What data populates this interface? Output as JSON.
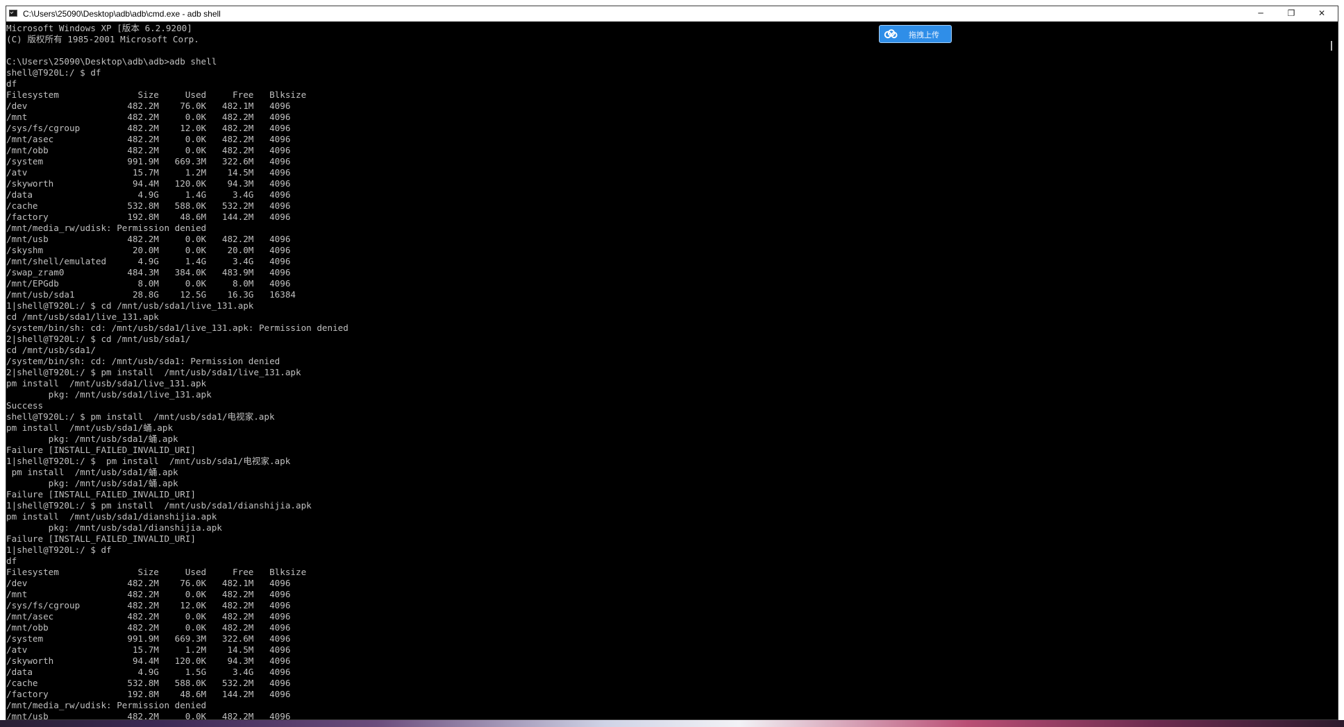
{
  "window": {
    "title": "C:\\Users\\25090\\Desktop\\adb\\adb\\cmd.exe - adb shell",
    "buttons": {
      "minimize": "─",
      "maximize": "❐",
      "close": "✕"
    }
  },
  "upload_widget": {
    "label": "拖拽上传",
    "color": "#2f8ee8",
    "icon": "cloud-icon"
  },
  "console": {
    "text_color": "#c0c0c0",
    "background": "#000000",
    "text": "Microsoft Windows XP [版本 6.2.9200]\n(C) 版权所有 1985-2001 Microsoft Corp.\n\nC:\\Users\\25090\\Desktop\\adb\\adb>adb shell\nshell@T920L:/ $ df\ndf\nFilesystem               Size     Used     Free   Blksize\n/dev                   482.2M    76.0K   482.1M   4096\n/mnt                   482.2M     0.0K   482.2M   4096\n/sys/fs/cgroup         482.2M    12.0K   482.2M   4096\n/mnt/asec              482.2M     0.0K   482.2M   4096\n/mnt/obb               482.2M     0.0K   482.2M   4096\n/system                991.9M   669.3M   322.6M   4096\n/atv                    15.7M     1.2M    14.5M   4096\n/skyworth               94.4M   120.0K    94.3M   4096\n/data                    4.9G     1.4G     3.4G   4096\n/cache                 532.8M   588.0K   532.2M   4096\n/factory               192.8M    48.6M   144.2M   4096\n/mnt/media_rw/udisk: Permission denied\n/mnt/usb               482.2M     0.0K   482.2M   4096\n/skyshm                 20.0M     0.0K    20.0M   4096\n/mnt/shell/emulated      4.9G     1.4G     3.4G   4096\n/swap_zram0            484.3M   384.0K   483.9M   4096\n/mnt/EPGdb               8.0M     0.0K     8.0M   4096\n/mnt/usb/sda1           28.8G    12.5G    16.3G   16384\n1|shell@T920L:/ $ cd /mnt/usb/sda1/live_131.apk\ncd /mnt/usb/sda1/live_131.apk\n/system/bin/sh: cd: /mnt/usb/sda1/live_131.apk: Permission denied\n2|shell@T920L:/ $ cd /mnt/usb/sda1/\ncd /mnt/usb/sda1/\n/system/bin/sh: cd: /mnt/usb/sda1: Permission denied\n2|shell@T920L:/ $ pm install  /mnt/usb/sda1/live_131.apk\npm install  /mnt/usb/sda1/live_131.apk\n        pkg: /mnt/usb/sda1/live_131.apk\nSuccess\nshell@T920L:/ $ pm install  /mnt/usb/sda1/电视家.apk\npm install  /mnt/usb/sda1/蛹.apk\n        pkg: /mnt/usb/sda1/蛹.apk\nFailure [INSTALL_FAILED_INVALID_URI]\n1|shell@T920L:/ $  pm install  /mnt/usb/sda1/电视家.apk\n pm install  /mnt/usb/sda1/蛹.apk\n        pkg: /mnt/usb/sda1/蛹.apk\nFailure [INSTALL_FAILED_INVALID_URI]\n1|shell@T920L:/ $ pm install  /mnt/usb/sda1/dianshijia.apk\npm install  /mnt/usb/sda1/dianshijia.apk\n        pkg: /mnt/usb/sda1/dianshijia.apk\nFailure [INSTALL_FAILED_INVALID_URI]\n1|shell@T920L:/ $ df\ndf\nFilesystem               Size     Used     Free   Blksize\n/dev                   482.2M    76.0K   482.1M   4096\n/mnt                   482.2M     0.0K   482.2M   4096\n/sys/fs/cgroup         482.2M    12.0K   482.2M   4096\n/mnt/asec              482.2M     0.0K   482.2M   4096\n/mnt/obb               482.2M     0.0K   482.2M   4096\n/system                991.9M   669.3M   322.6M   4096\n/atv                    15.7M     1.2M    14.5M   4096\n/skyworth               94.4M   120.0K    94.3M   4096\n/data                    4.9G     1.5G     3.4G   4096\n/cache                 532.8M   588.0K   532.2M   4096\n/factory               192.8M    48.6M   144.2M   4096\n/mnt/media_rw/udisk: Permission denied\n/mnt/usb               482.2M     0.0K   482.2M   4096"
  }
}
